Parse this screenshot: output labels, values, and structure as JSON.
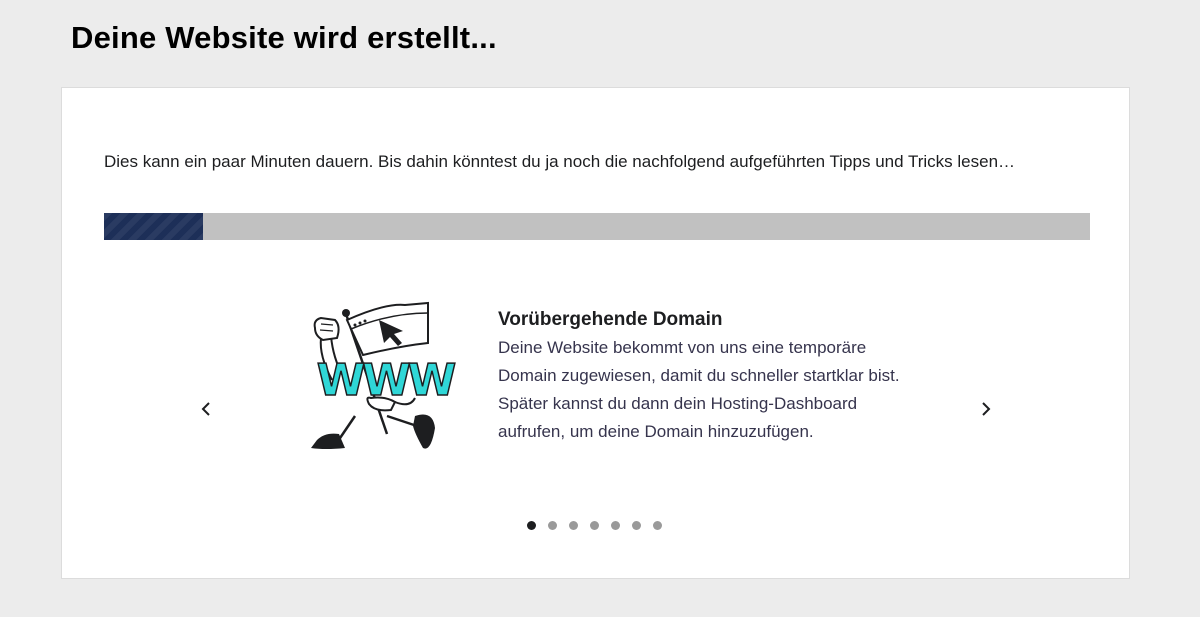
{
  "page": {
    "title": "Deine Website wird erstellt..."
  },
  "card": {
    "intro_text": "Dies kann ein paar Minuten dauern. Bis dahin könntest du ja noch die nachfolgend aufgeführten Tipps und Tricks lesen…",
    "progress": {
      "fraction": 0.1,
      "fill_color": "#1d2f58",
      "track_color": "#c1c1c1"
    },
    "carousel": {
      "prev_icon": "chevron-left-icon",
      "next_icon": "chevron-right-icon",
      "slide": {
        "title": "Vorübergehende Domain",
        "body": "Deine Website bekommt von uns eine temporäre Domain zugewiesen, damit du schneller startklar bist. Später kannst du dann dein Hosting-Dashboard aufrufen, um deine Domain hinzuzufügen.",
        "illustration": {
          "name": "www-flag-illustration-icon",
          "text": "WWW",
          "accent_color": "#2fd7d7"
        }
      },
      "slide_count": 7,
      "active_index": 0
    }
  }
}
